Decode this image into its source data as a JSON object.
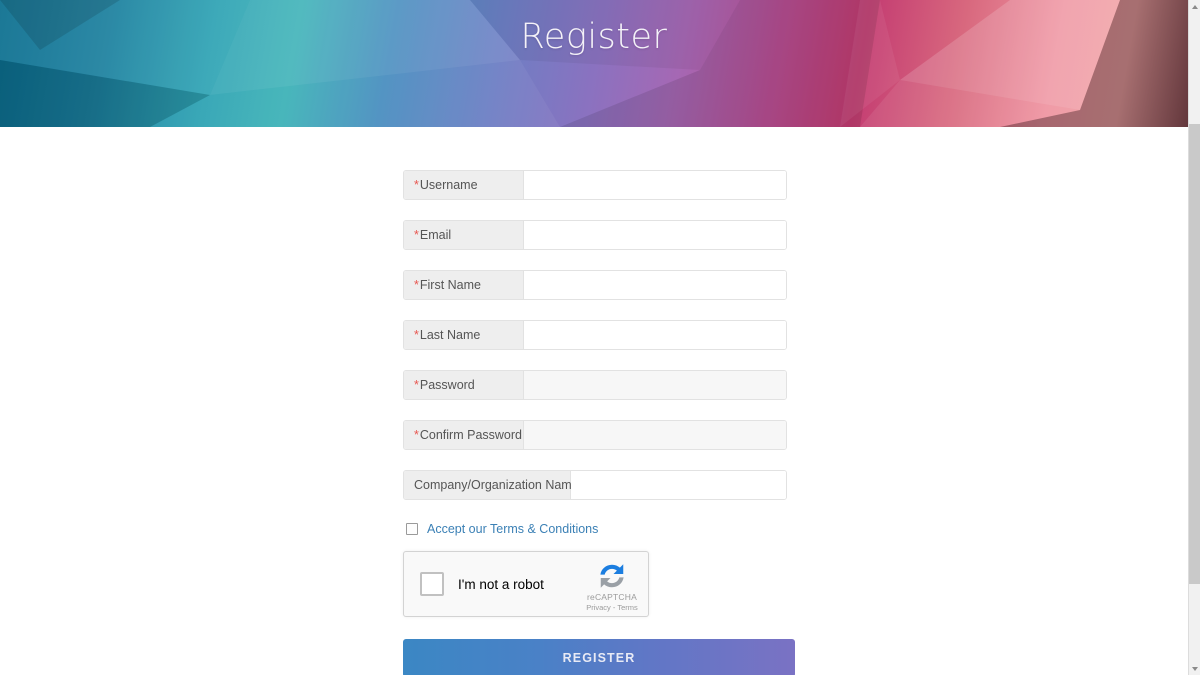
{
  "banner": {
    "title": "Register",
    "gradient_start": "#0a6e8f",
    "gradient_mid": "#8a72c0",
    "gradient_end": "#ef93a0"
  },
  "form": {
    "fields": [
      {
        "label": "Username",
        "required": true,
        "value": "",
        "placeholder": "",
        "shaded": false,
        "label_width": "w-req"
      },
      {
        "label": "Email",
        "required": true,
        "value": "",
        "placeholder": "",
        "shaded": false,
        "label_width": "w-req"
      },
      {
        "label": "First Name",
        "required": true,
        "value": "",
        "placeholder": "",
        "shaded": false,
        "label_width": "w-req"
      },
      {
        "label": "Last Name",
        "required": true,
        "value": "",
        "placeholder": "",
        "shaded": false,
        "label_width": "w-req"
      },
      {
        "label": "Password",
        "required": true,
        "value": "",
        "placeholder": "",
        "shaded": true,
        "label_width": "w-req"
      },
      {
        "label": "Confirm Password",
        "required": true,
        "value": "",
        "placeholder": "",
        "shaded": true,
        "label_width": "w-req"
      },
      {
        "label": "Company/Organization Name",
        "required": false,
        "value": "",
        "placeholder": "",
        "shaded": false,
        "label_width": "w-company"
      }
    ],
    "required_marker": "*",
    "terms": {
      "link_text": "Accept our Terms & Conditions",
      "checked": false,
      "link_color": "#3b80b5"
    },
    "recaptcha": {
      "label": "I'm not a robot",
      "brand": "reCAPTCHA",
      "legal": "Privacy - Terms",
      "checked": false
    },
    "submit": {
      "label": "REGISTER",
      "color_start": "#3b87c4",
      "color_end": "#7a72c4"
    }
  },
  "scrollbar": {
    "up_arrow": "scroll-up",
    "down_arrow": "scroll-down"
  }
}
